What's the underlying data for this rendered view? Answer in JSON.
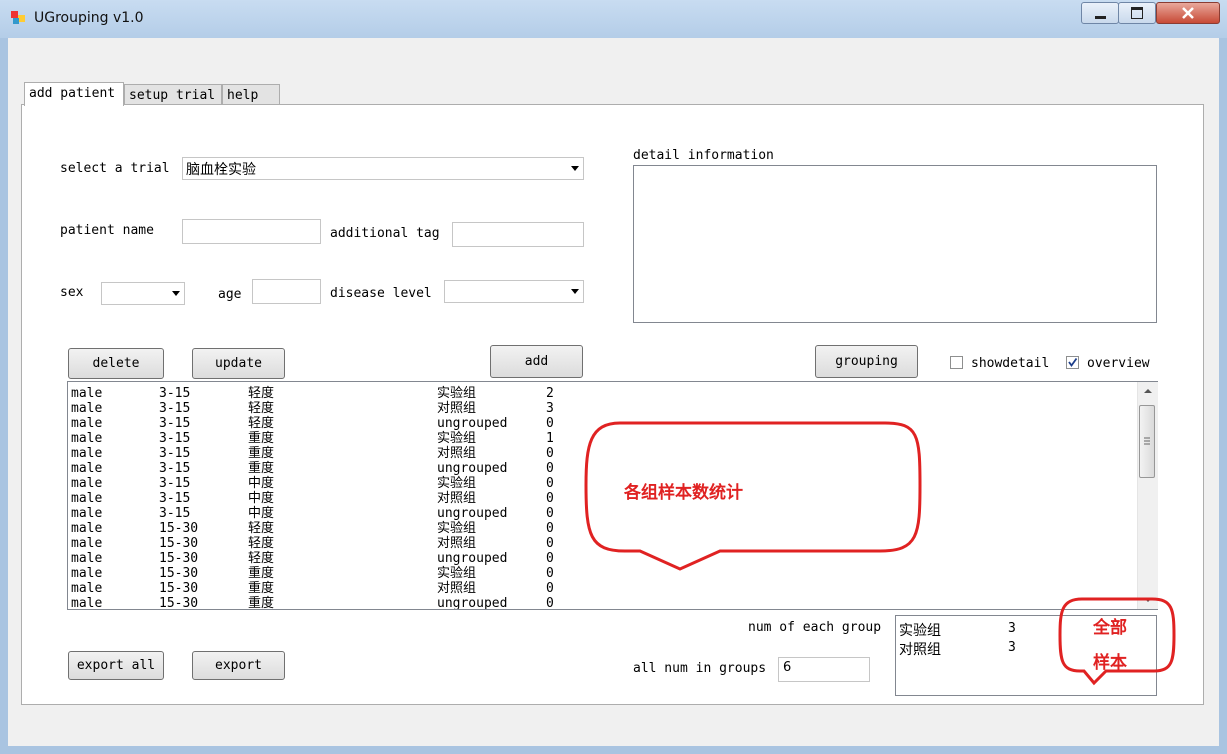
{
  "window": {
    "title": "UGrouping v1.0"
  },
  "tabs": [
    {
      "label": "add patient",
      "active": true
    },
    {
      "label": "setup trial",
      "active": false
    },
    {
      "label": "help",
      "active": false
    }
  ],
  "form": {
    "trial_label": "select a trial",
    "trial_value": "脑血栓实验",
    "patient_name_label": "patient name",
    "patient_name_value": "",
    "additional_tag_label": "additional tag",
    "additional_tag_value": "",
    "sex_label": "sex",
    "sex_value": "",
    "age_label": "age",
    "age_value": "",
    "disease_level_label": "disease level",
    "disease_level_value": "",
    "detail_label": "detail information",
    "detail_value": ""
  },
  "buttons": {
    "delete": "delete",
    "update": "update",
    "add": "add",
    "grouping": "grouping",
    "export_all": "export all",
    "export": "export"
  },
  "options": {
    "showdetail_label": "showdetail",
    "showdetail_checked": false,
    "overview_label": "overview",
    "overview_checked": true
  },
  "list_rows": [
    [
      "male",
      "3-15",
      "轻度",
      "实验组",
      "2"
    ],
    [
      "male",
      "3-15",
      "轻度",
      "对照组",
      "3"
    ],
    [
      "male",
      "3-15",
      "轻度",
      "ungrouped",
      "0"
    ],
    [
      "male",
      "3-15",
      "重度",
      "实验组",
      "1"
    ],
    [
      "male",
      "3-15",
      "重度",
      "对照组",
      "0"
    ],
    [
      "male",
      "3-15",
      "重度",
      "ungrouped",
      "0"
    ],
    [
      "male",
      "3-15",
      "中度",
      "实验组",
      "0"
    ],
    [
      "male",
      "3-15",
      "中度",
      "对照组",
      "0"
    ],
    [
      "male",
      "3-15",
      "中度",
      "ungrouped",
      "0"
    ],
    [
      "male",
      "15-30",
      "轻度",
      "实验组",
      "0"
    ],
    [
      "male",
      "15-30",
      "轻度",
      "对照组",
      "0"
    ],
    [
      "male",
      "15-30",
      "轻度",
      "ungrouped",
      "0"
    ],
    [
      "male",
      "15-30",
      "重度",
      "实验组",
      "0"
    ],
    [
      "male",
      "15-30",
      "重度",
      "对照组",
      "0"
    ],
    [
      "male",
      "15-30",
      "重度",
      "ungrouped",
      "0"
    ]
  ],
  "summary": {
    "num_each_label": "num of each group",
    "groups": [
      {
        "name": "实验组",
        "count": "3"
      },
      {
        "name": "对照组",
        "count": "3"
      }
    ],
    "all_num_label": "all num in groups",
    "all_num_value": "6"
  },
  "annotations": {
    "callout_1": "各组样本数统计",
    "callout_2_line1": "全部",
    "callout_2_line2": "样本",
    "color": "#e02222"
  }
}
